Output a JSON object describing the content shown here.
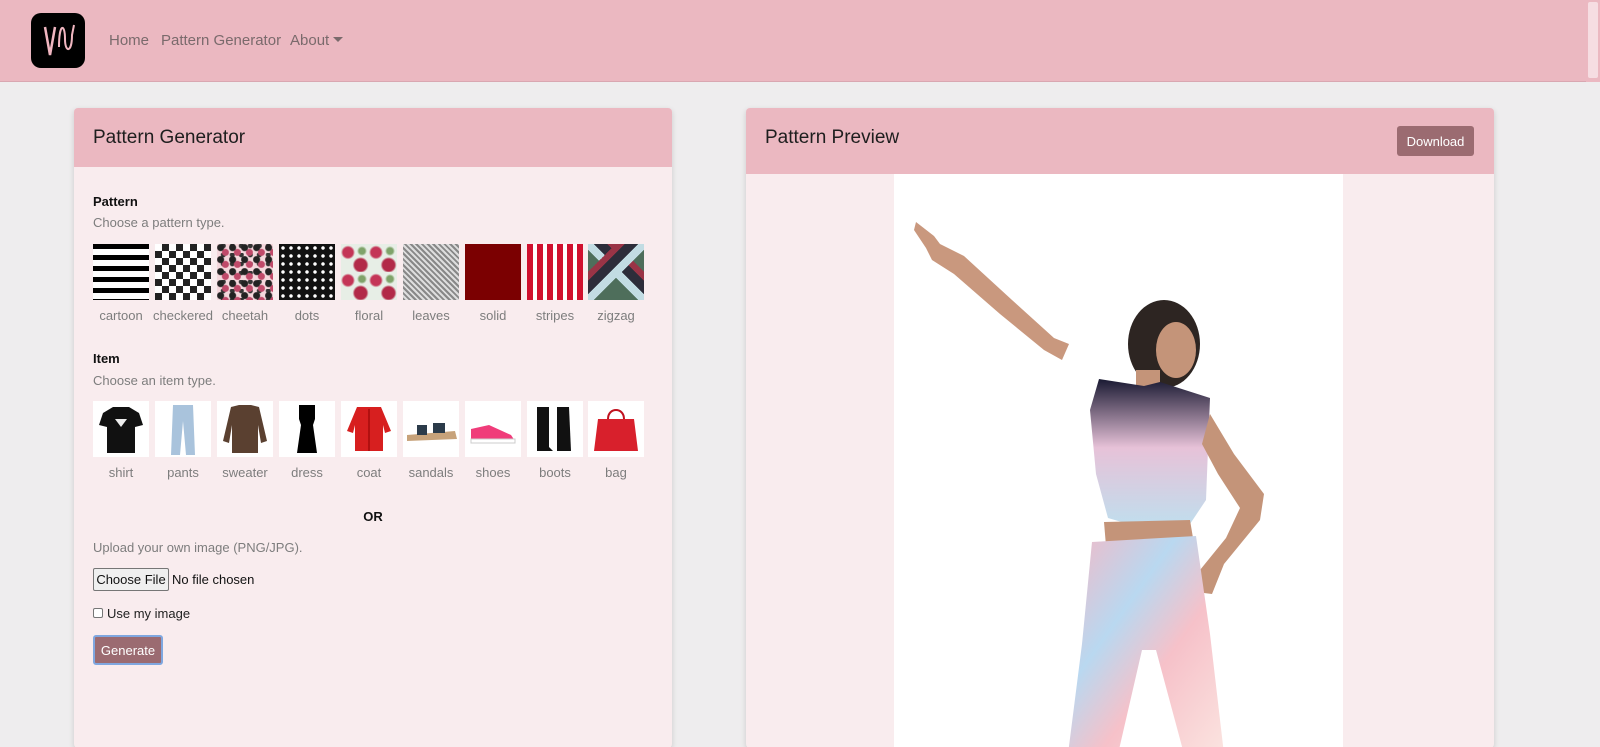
{
  "nav": {
    "home": "Home",
    "pattern_generator": "Pattern Generator",
    "about": "About"
  },
  "generator": {
    "title": "Pattern Generator",
    "pattern_heading": "Pattern",
    "pattern_hint": "Choose a pattern type.",
    "patterns": [
      "cartoon",
      "checkered",
      "cheetah",
      "dots",
      "floral",
      "leaves",
      "solid",
      "stripes",
      "zigzag"
    ],
    "item_heading": "Item",
    "item_hint": "Choose an item type.",
    "items": [
      "shirt",
      "pants",
      "sweater",
      "dress",
      "coat",
      "sandals",
      "shoes",
      "boots",
      "bag"
    ],
    "or_label": "OR",
    "upload_hint": "Upload your own image (PNG/JPG).",
    "choose_file_label": "Choose File",
    "file_status": "No file chosen",
    "use_my_image_label": "Use my image",
    "generate_label": "Generate"
  },
  "preview": {
    "title": "Pattern Preview",
    "download_label": "Download"
  },
  "colors": {
    "navbar": "#ebb8c1",
    "card_body": "#f9ecee",
    "button": "#9b6b71"
  }
}
